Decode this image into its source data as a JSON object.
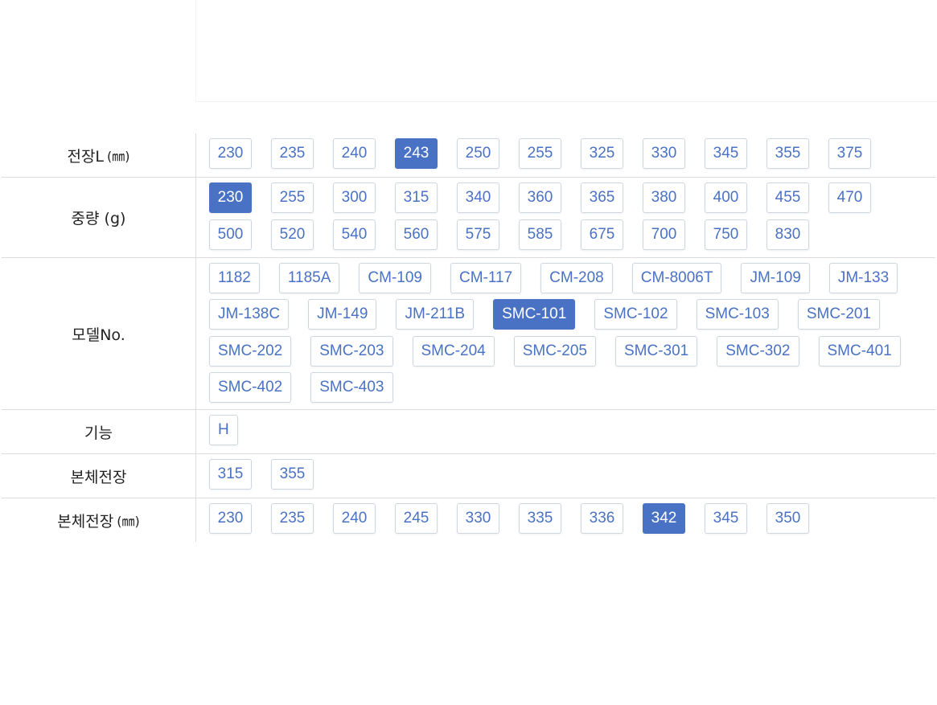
{
  "filters": {
    "length": {
      "label": "전장L",
      "unit": "(㎜)",
      "options": [
        "230",
        "235",
        "240",
        "243",
        "250",
        "255",
        "325",
        "330",
        "345",
        "355",
        "375"
      ],
      "selected": "243"
    },
    "weight": {
      "label": "중량 (g)",
      "options": [
        "230",
        "255",
        "300",
        "315",
        "340",
        "360",
        "365",
        "380",
        "400",
        "455",
        "470",
        "500",
        "520",
        "540",
        "560",
        "575",
        "585",
        "675",
        "700",
        "750",
        "830"
      ],
      "selected": "230"
    },
    "model": {
      "label": "모델No.",
      "options": [
        "1182",
        "1185A",
        "CM-109",
        "CM-117",
        "CM-208",
        "CM-8006T",
        "JM-109",
        "JM-133",
        "JM-138C",
        "JM-149",
        "JM-211B",
        "SMC-101",
        "SMC-102",
        "SMC-103",
        "SMC-201",
        "SMC-202",
        "SMC-203",
        "SMC-204",
        "SMC-205",
        "SMC-301",
        "SMC-302",
        "SMC-401",
        "SMC-402",
        "SMC-403"
      ],
      "selected": "SMC-101"
    },
    "function": {
      "label": "기능",
      "options": [
        "H"
      ],
      "selected": null
    },
    "body_length": {
      "label": "본체전장",
      "options": [
        "315",
        "355"
      ],
      "selected": null
    },
    "body_length_mm": {
      "label": "본체전장",
      "unit": "(㎜)",
      "options": [
        "230",
        "235",
        "240",
        "245",
        "330",
        "335",
        "336",
        "342",
        "345",
        "350"
      ],
      "selected": "342"
    }
  },
  "colors": {
    "accent": "#4a72c4",
    "option_text": "#4a72c4",
    "border": "#dcdcdc"
  }
}
